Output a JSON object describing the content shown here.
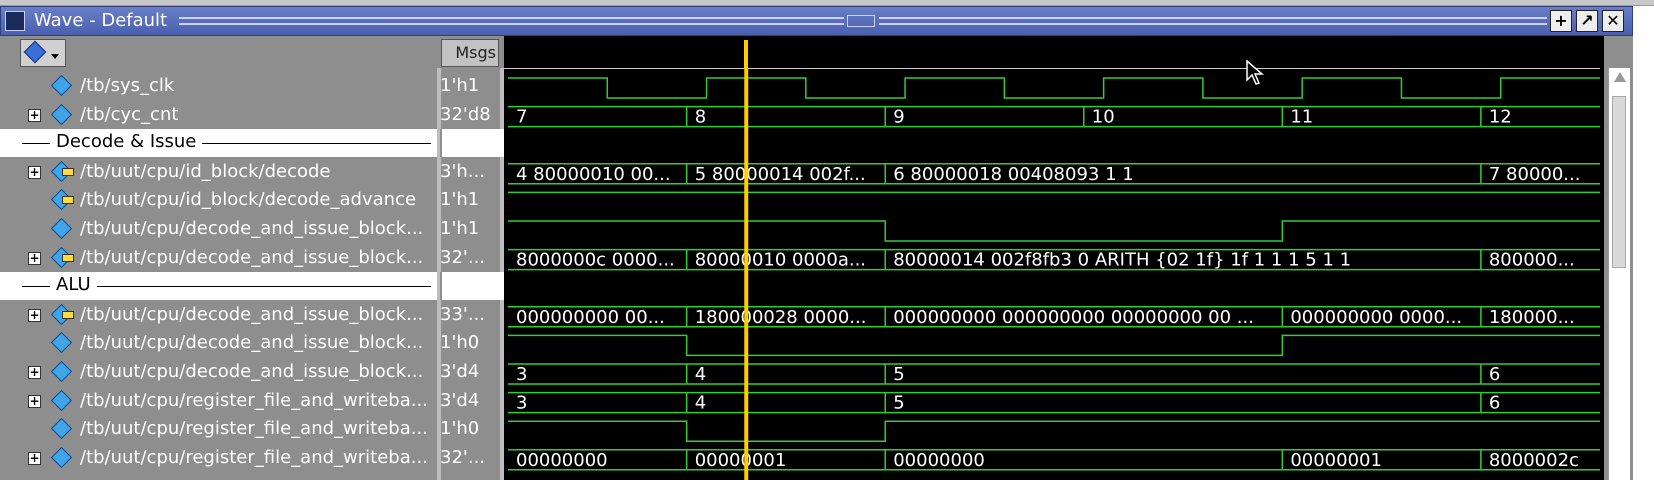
{
  "window": {
    "title": "Wave - Default",
    "buttons": [
      "+",
      "↗",
      "✕"
    ]
  },
  "header": {
    "msgs_label": "Msgs"
  },
  "colors": {
    "wave": "#33cc33",
    "cursor": "#ffcc00",
    "background": "#000000",
    "panel": "#8e8e8e"
  },
  "signals": [
    {
      "kind": "signal",
      "name": "/tb/sys_clk",
      "msg": "1'h1",
      "expand": false,
      "icon": "wire-icon",
      "wave": {
        "type": "clock",
        "period": 200,
        "start_high": true
      }
    },
    {
      "kind": "signal",
      "name": "/tb/cyc_cnt",
      "msg": "32'd8",
      "expand": true,
      "icon": "wire-icon",
      "wave": {
        "type": "bus",
        "segs": [
          [
            0,
            "7"
          ],
          [
            180,
            "8"
          ],
          [
            380,
            "9"
          ],
          [
            580,
            "10"
          ],
          [
            780,
            "11"
          ],
          [
            980,
            "12"
          ]
        ]
      }
    },
    {
      "kind": "divider",
      "name": "Decode & Issue"
    },
    {
      "kind": "signal",
      "name": "/tb/uut/cpu/id_block/decode",
      "msg": "3'h...",
      "expand": true,
      "icon": "struct-icon",
      "wave": {
        "type": "bus",
        "segs": [
          [
            0,
            "4 80000010 00..."
          ],
          [
            180,
            "5 80000014 002f..."
          ],
          [
            380,
            "6 80000018 00408093 1 1"
          ],
          [
            980,
            "7 80000..."
          ]
        ]
      }
    },
    {
      "kind": "signal",
      "name": "/tb/uut/cpu/id_block/decode_advance",
      "msg": "1'h1",
      "expand": false,
      "icon": "struct-icon",
      "wave": {
        "type": "bit",
        "edges": [
          [
            0,
            1
          ]
        ]
      }
    },
    {
      "kind": "signal",
      "name": "/tb/uut/cpu/decode_and_issue_block...",
      "msg": "1'h1",
      "expand": false,
      "icon": "wire-icon",
      "wave": {
        "type": "bit",
        "edges": [
          [
            0,
            1
          ],
          [
            380,
            0
          ],
          [
            780,
            1
          ]
        ]
      }
    },
    {
      "kind": "signal",
      "name": "/tb/uut/cpu/decode_and_issue_block...",
      "msg": "32'...",
      "expand": true,
      "icon": "struct-icon",
      "wave": {
        "type": "bus",
        "segs": [
          [
            0,
            "8000000c 0000..."
          ],
          [
            180,
            "80000010 0000a..."
          ],
          [
            380,
            "80000014 002f8fb3 0 ARITH {02 1f} 1f 1 1 1 5 1 1"
          ],
          [
            980,
            "800000..."
          ]
        ]
      }
    },
    {
      "kind": "divider",
      "name": "ALU"
    },
    {
      "kind": "signal",
      "name": "/tb/uut/cpu/decode_and_issue_block...",
      "msg": "33'...",
      "expand": true,
      "icon": "struct-icon",
      "wave": {
        "type": "bus",
        "segs": [
          [
            0,
            "000000000 00..."
          ],
          [
            180,
            "180000028 0000..."
          ],
          [
            380,
            "000000000 000000000 00000000 00 ..."
          ],
          [
            780,
            "000000000 0000..."
          ],
          [
            980,
            "180000..."
          ]
        ]
      }
    },
    {
      "kind": "signal",
      "name": "/tb/uut/cpu/decode_and_issue_block...",
      "msg": "1'h0",
      "expand": false,
      "icon": "wire-icon",
      "wave": {
        "type": "bit",
        "edges": [
          [
            0,
            1
          ],
          [
            180,
            0
          ],
          [
            780,
            1
          ]
        ]
      }
    },
    {
      "kind": "signal",
      "name": "/tb/uut/cpu/decode_and_issue_block...",
      "msg": "3'd4",
      "expand": true,
      "icon": "wire-icon",
      "wave": {
        "type": "bus",
        "segs": [
          [
            0,
            "3"
          ],
          [
            180,
            "4"
          ],
          [
            380,
            "5"
          ],
          [
            980,
            "6"
          ]
        ]
      }
    },
    {
      "kind": "signal",
      "name": "/tb/uut/cpu/register_file_and_writeba...",
      "msg": "3'd4",
      "expand": true,
      "icon": "wire-icon",
      "wave": {
        "type": "bus",
        "segs": [
          [
            0,
            "3"
          ],
          [
            180,
            "4"
          ],
          [
            380,
            "5"
          ],
          [
            980,
            "6"
          ]
        ]
      }
    },
    {
      "kind": "signal",
      "name": "/tb/uut/cpu/register_file_and_writeba...",
      "msg": "1'h0",
      "expand": false,
      "icon": "wire-icon",
      "wave": {
        "type": "bit",
        "edges": [
          [
            0,
            1
          ],
          [
            180,
            0
          ],
          [
            380,
            1
          ]
        ]
      }
    },
    {
      "kind": "signal",
      "name": "/tb/uut/cpu/register_file_and_writeba...",
      "msg": "32'...",
      "expand": true,
      "icon": "wire-icon",
      "wave": {
        "type": "bus",
        "segs": [
          [
            0,
            "00000000"
          ],
          [
            180,
            "00000001"
          ],
          [
            380,
            "00000000"
          ],
          [
            780,
            "00000001"
          ],
          [
            980,
            "8000002c"
          ]
        ]
      }
    }
  ],
  "cursor_time": 240,
  "time_span": 1100
}
